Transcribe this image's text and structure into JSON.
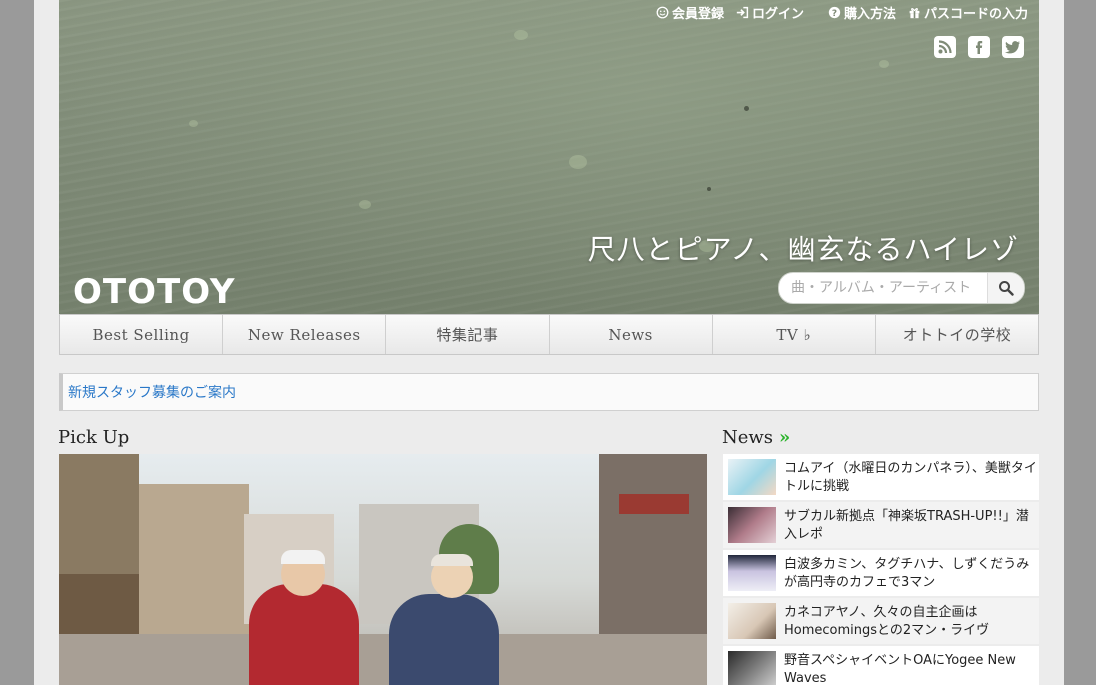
{
  "header": {
    "links": [
      {
        "label": "会員登録",
        "icon": "smiley-icon"
      },
      {
        "label": "ログイン",
        "icon": "login-icon"
      },
      {
        "label": "購入方法",
        "icon": "question-icon"
      },
      {
        "label": "パスコードの入力",
        "icon": "gift-icon"
      }
    ],
    "social": [
      "rss-icon",
      "facebook-icon",
      "twitter-icon"
    ],
    "tagline": "尺八とピアノ、幽玄なるハイレゾ",
    "logo": "OTOTOY",
    "search": {
      "placeholder": "曲・アルバム・アーティスト"
    }
  },
  "nav": {
    "items": [
      "Best Selling",
      "New Releases",
      "特集記事",
      "News",
      "TV ♭",
      "オトトイの学校"
    ]
  },
  "notice": {
    "text": "新規スタッフ募集のご案内"
  },
  "pickup": {
    "title": "Pick Up"
  },
  "news": {
    "title": "News",
    "items": [
      {
        "text": "コムアイ（水曜日のカンパネラ）、美獣タイトルに挑戦"
      },
      {
        "text": "サブカル新拠点「神楽坂TRASH-UP!!」潜入レポ"
      },
      {
        "text": "白波多カミン、タグチハナ、しずくだうみが高円寺のカフェで3マン"
      },
      {
        "text": "カネコアヤノ、久々の自主企画はHomecomingsとの2マン・ライヴ"
      },
      {
        "text": "野音スペシャイベントOAにYogee New Waves"
      }
    ]
  },
  "colors": {
    "link": "#2a78c8",
    "news_chevron": "#2ab32a",
    "hero": "#7f8b77"
  }
}
